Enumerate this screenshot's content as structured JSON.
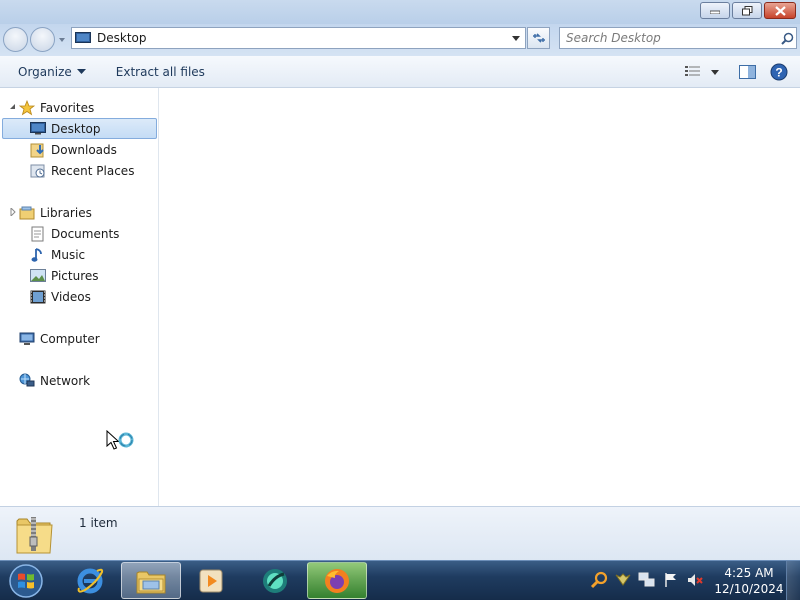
{
  "window": {
    "controls": [
      "minimize",
      "restore",
      "close"
    ]
  },
  "address_bar": {
    "location": "Desktop",
    "search_placeholder": "Search Desktop"
  },
  "toolbar": {
    "organize_label": "Organize",
    "extract_label": "Extract all files"
  },
  "nav_pane": {
    "favorites": {
      "label": "Favorites",
      "items": [
        {
          "label": "Desktop",
          "icon": "desktop-icon",
          "selected": true
        },
        {
          "label": "Downloads",
          "icon": "downloads-icon"
        },
        {
          "label": "Recent Places",
          "icon": "recent-places-icon"
        }
      ]
    },
    "libraries": {
      "label": "Libraries",
      "items": [
        {
          "label": "Documents",
          "icon": "documents-icon"
        },
        {
          "label": "Music",
          "icon": "music-icon"
        },
        {
          "label": "Pictures",
          "icon": "pictures-icon"
        },
        {
          "label": "Videos",
          "icon": "videos-icon"
        }
      ]
    },
    "computer": {
      "label": "Computer",
      "icon": "computer-icon"
    },
    "network": {
      "label": "Network",
      "icon": "network-icon"
    }
  },
  "details_pane": {
    "item_count": "1 item",
    "icon": "zip-folder-icon"
  },
  "taskbar": {
    "pinned": [
      "internet-explorer-icon",
      "file-explorer-icon",
      "media-player-icon",
      "app-icon",
      "firefox-icon"
    ],
    "clock_time": "4:25 AM",
    "clock_date": "12/10/2024"
  },
  "colors": {
    "selection": "#c4dcf5",
    "taskbar": "#1f3c60",
    "titlebar": "#c9daee"
  }
}
